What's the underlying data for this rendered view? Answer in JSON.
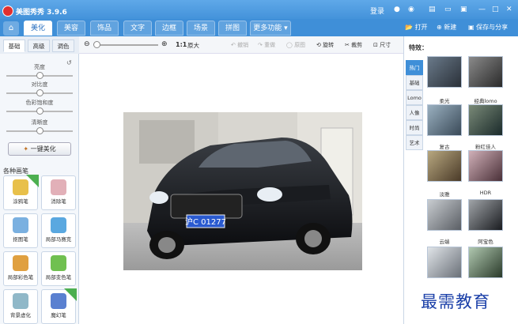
{
  "window": {
    "title": "美图秀秀 3.9.6",
    "login_label": "登录"
  },
  "nav": {
    "tabs": [
      {
        "label": "美化"
      },
      {
        "label": "美容"
      },
      {
        "label": "饰品"
      },
      {
        "label": "文字"
      },
      {
        "label": "边框"
      },
      {
        "label": "场景"
      },
      {
        "label": "拼图"
      },
      {
        "label": "更多功能"
      }
    ],
    "open_label": "打开",
    "new_label": "新建",
    "save_label": "保存与分享"
  },
  "toolbar": {
    "ratio_label": "1:1",
    "original_label": "原大",
    "undo_label": "撤销",
    "redo_label": "重做",
    "restore_label": "原图",
    "rotate_label": "旋转",
    "crop_label": "裁剪",
    "size_label": "尺寸"
  },
  "left": {
    "subtabs": [
      {
        "label": "基础"
      },
      {
        "label": "高级"
      },
      {
        "label": "调色"
      }
    ],
    "sliders": [
      {
        "label": "亮度",
        "value": 0.5
      },
      {
        "label": "对比度",
        "value": 0.5
      },
      {
        "label": "色彩饱和度",
        "value": 0.5
      },
      {
        "label": "清晰度",
        "value": 0.5
      }
    ],
    "onekey_label": "一键美化",
    "brush_title": "各种画笔",
    "brushes": [
      {
        "label": "涂鸦笔"
      },
      {
        "label": "消除笔"
      },
      {
        "label": "抠图笔"
      },
      {
        "label": "局部马赛克"
      },
      {
        "label": "局部彩色笔"
      },
      {
        "label": "局部变色笔"
      },
      {
        "label": "背景虚化"
      },
      {
        "label": "魔幻笔"
      }
    ]
  },
  "image": {
    "plate_text": "沪C 01277"
  },
  "effects": {
    "title": "特效：",
    "categories": [
      {
        "label": "热门"
      },
      {
        "label": "基础"
      },
      {
        "label": "Lomo"
      },
      {
        "label": "人像"
      },
      {
        "label": "时尚"
      },
      {
        "label": "艺术"
      }
    ],
    "thumbs": [
      {
        "label": ""
      },
      {
        "label": ""
      },
      {
        "label": "柔光"
      },
      {
        "label": "经典lomo"
      },
      {
        "label": "复古"
      },
      {
        "label": "粉红佳人"
      },
      {
        "label": "淡雅"
      },
      {
        "label": "HDR"
      },
      {
        "label": "云端"
      },
      {
        "label": "阿宝色"
      }
    ]
  },
  "watermark": "最需教育",
  "colors": {
    "title_bg": "#3f8fd8",
    "accent": "#2a70c0"
  }
}
